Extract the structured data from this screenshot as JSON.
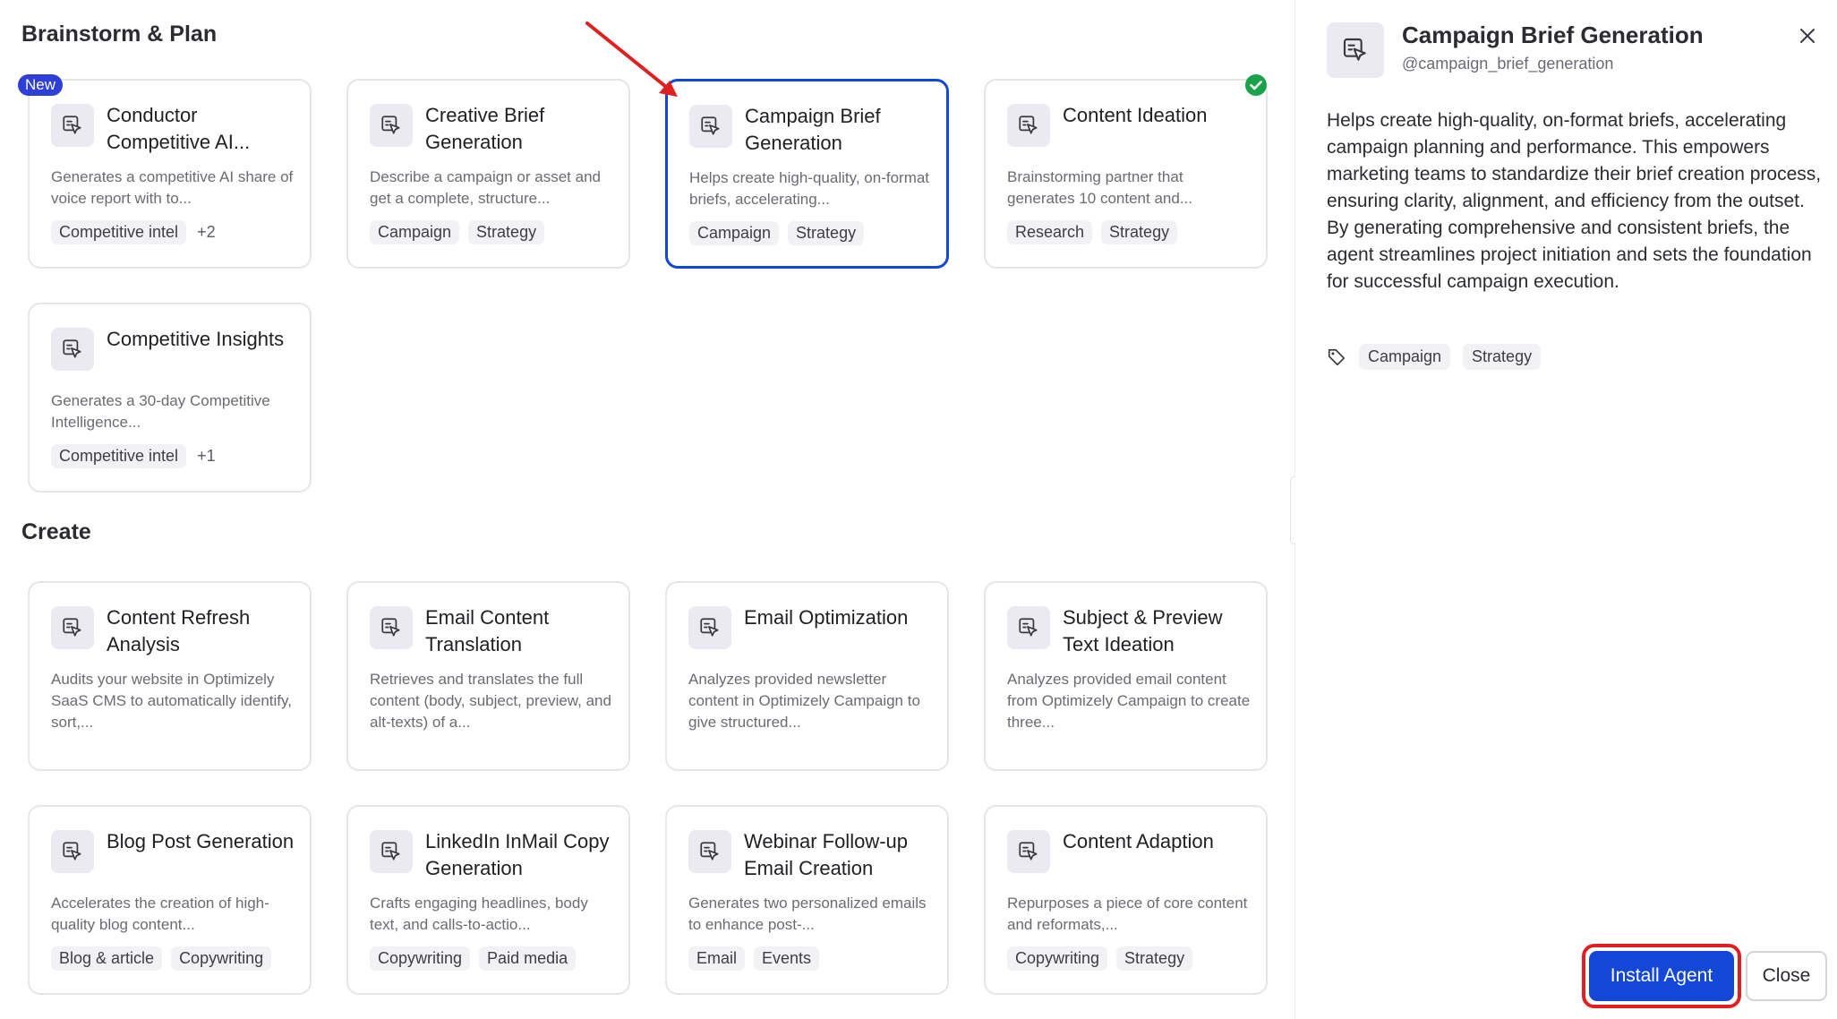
{
  "sections": {
    "brainstorm": "Brainstorm & Plan",
    "create": "Create"
  },
  "badge_new": "New",
  "cards": [
    {
      "title": "Conductor Competitive AI...",
      "desc": "Generates a competitive AI share of voice report with to...",
      "tags": [
        "Competitive intel"
      ],
      "more": "+2"
    },
    {
      "title": "Creative Brief Generation",
      "desc": "Describe a campaign or asset and get a complete, structure...",
      "tags": [
        "Campaign",
        "Strategy"
      ],
      "more": ""
    },
    {
      "title": "Campaign Brief Generation",
      "desc": "Helps create high-quality, on-format briefs, accelerating...",
      "tags": [
        "Campaign",
        "Strategy"
      ],
      "more": ""
    },
    {
      "title": "Content Ideation",
      "desc": "Brainstorming partner that generates 10 content and...",
      "tags": [
        "Research",
        "Strategy"
      ],
      "more": ""
    },
    {
      "title": "Competitive Insights",
      "desc": "Generates a 30-day Competitive Intelligence...",
      "tags": [
        "Competitive intel"
      ],
      "more": "+1"
    },
    {
      "title": "Content Refresh Analysis",
      "desc": "Audits your website in Optimizely SaaS CMS to automatically identify, sort,...",
      "tags": [],
      "more": ""
    },
    {
      "title": "Email Content Translation",
      "desc": "Retrieves and translates the full content (body, subject, preview, and alt-texts) of a...",
      "tags": [],
      "more": ""
    },
    {
      "title": "Email Optimization",
      "desc": "Analyzes provided newsletter content in Optimizely Campaign to give structured...",
      "tags": [],
      "more": ""
    },
    {
      "title": "Subject & Preview Text Ideation",
      "desc": "Analyzes provided email content from Optimizely Campaign to create three...",
      "tags": [],
      "more": ""
    },
    {
      "title": "Blog Post Generation",
      "desc": "Accelerates the creation of high-quality blog content...",
      "tags": [
        "Blog & article",
        "Copywriting"
      ],
      "more": ""
    },
    {
      "title": "LinkedIn InMail Copy Generation",
      "desc": "Crafts engaging headlines, body text, and calls-to-actio...",
      "tags": [
        "Copywriting",
        "Paid media"
      ],
      "more": ""
    },
    {
      "title": "Webinar Follow-up Email Creation",
      "desc": "Generates two personalized emails to enhance post-...",
      "tags": [
        "Email",
        "Events"
      ],
      "more": ""
    },
    {
      "title": "Content Adaption",
      "desc": "Repurposes a piece of core content and reformats,...",
      "tags": [
        "Copywriting",
        "Strategy"
      ],
      "more": ""
    }
  ],
  "panel": {
    "title": "Campaign Brief Generation",
    "handle": "@campaign_brief_generation",
    "description": "Helps create high-quality, on-format briefs, accelerating campaign planning and performance. This empowers marketing teams to standardize their brief creation process, ensuring clarity, alignment, and efficiency from the outset. By generating comprehensive and consistent briefs, the agent streamlines project initiation and sets the foundation for successful campaign execution.",
    "tags": [
      "Campaign",
      "Strategy"
    ],
    "install_label": "Install Agent",
    "close_label": "Close"
  },
  "icons": {
    "agent": "agent-cursor-icon",
    "close": "close-icon",
    "tag": "tag-icon",
    "check": "check-circle-icon",
    "annotation": "red-arrow-annotation"
  },
  "colors": {
    "accent": "#1347d8",
    "badge": "#2d3fd6",
    "check": "#1aa34a",
    "annotation": "#e02020",
    "icon_bg": "#ebe9f1"
  }
}
